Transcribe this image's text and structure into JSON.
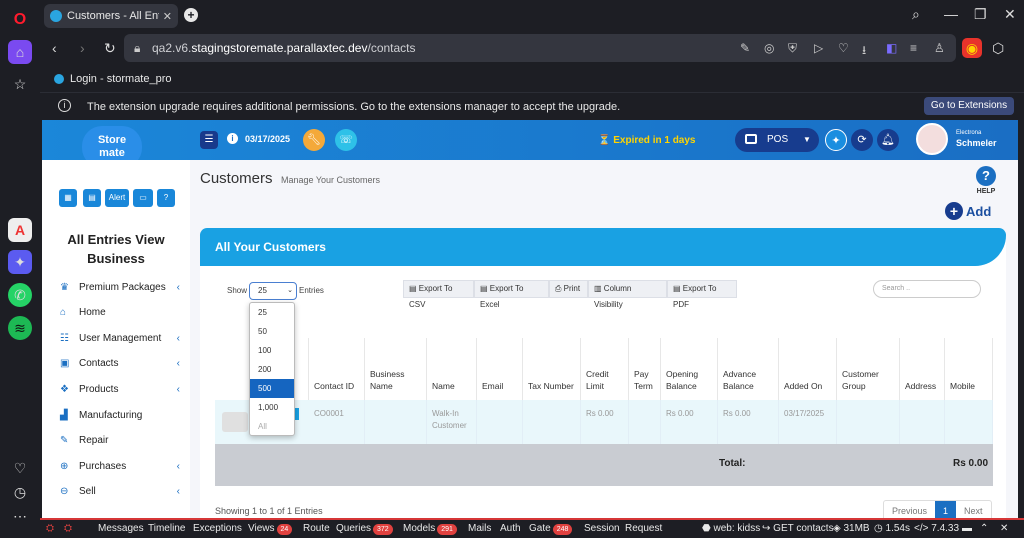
{
  "browser": {
    "tab_title": "Customers - All Entries Vi",
    "url_prefix": "qa2.v6.",
    "url_host": "stagingstoremate.parallaxtec.dev",
    "url_path": "/contacts",
    "bookmark": "Login - stormate_pro",
    "infobar_text": "The extension upgrade requires additional permissions. Go to the extensions manager to accept the upgrade.",
    "infobar_button": "Go to Extensions"
  },
  "topbar": {
    "date": "03/17/2025",
    "expired": "Expired in 1 days",
    "pos_label": "POS",
    "user_line1": "Electrona",
    "user_line2": "Schmeler"
  },
  "logo": {
    "line1": "Store",
    "line2": "mate"
  },
  "quick_buttons": {
    "alert": "Alert"
  },
  "business_name": "All Entries View Business",
  "nav": [
    {
      "label": "Premium Packages",
      "icon": "crown-icon",
      "chevron": true
    },
    {
      "label": "Home",
      "icon": "home-icon",
      "chevron": false
    },
    {
      "label": "User Management",
      "icon": "users-icon",
      "chevron": true
    },
    {
      "label": "Contacts",
      "icon": "contacts-icon",
      "chevron": true
    },
    {
      "label": "Products",
      "icon": "products-icon",
      "chevron": true
    },
    {
      "label": "Manufacturing",
      "icon": "factory-icon",
      "chevron": false
    },
    {
      "label": "Repair",
      "icon": "wrench-icon",
      "chevron": false
    },
    {
      "label": "Purchases",
      "icon": "download-circle-icon",
      "chevron": true
    },
    {
      "label": "Sell",
      "icon": "upload-circle-icon",
      "chevron": true
    }
  ],
  "page": {
    "title": "Customers",
    "subtitle": "Manage Your Customers",
    "help": "HELP",
    "add": "Add",
    "card_title": "All Your Customers",
    "show_label": "Show",
    "show_value": "25",
    "entries_label": "Entries",
    "search_placeholder": "Search ..",
    "showing_text": "Showing 1 to 1 of 1 Entries",
    "total_label": "Total:",
    "total_value": "Rs 0.00"
  },
  "export_buttons": [
    "Export To CSV",
    "Export To Excel",
    "Print",
    "Column Visibility",
    "Export To PDF"
  ],
  "columns": [
    "Contact ID",
    "Business Name",
    "Name",
    "Email",
    "Tax Number",
    "Credit Limit",
    "Pay Term",
    "Opening Balance",
    "Advance Balance",
    "Added On",
    "Customer Group",
    "Address",
    "Mobile"
  ],
  "rows": [
    {
      "contact_id": "CO0001",
      "business_name": "",
      "name": "Walk-In Customer",
      "email": "",
      "tax_number": "",
      "credit_limit": "Rs 0.00",
      "pay_term": "",
      "opening_balance": "Rs 0.00",
      "advance_balance": "Rs 0.00",
      "added_on": "03/17/2025",
      "customer_group": "",
      "address": "",
      "mobile": ""
    }
  ],
  "dropdown_options": [
    "25",
    "50",
    "100",
    "200",
    "500",
    "1,000",
    "All"
  ],
  "dropdown_highlighted": "500",
  "pagination": {
    "previous": "Previous",
    "current": "1",
    "next": "Next"
  },
  "debugbar": {
    "items": [
      "Messages",
      "Timeline",
      "Exceptions",
      "Views",
      "Route",
      "Queries",
      "Models",
      "Mails",
      "Auth",
      "Gate",
      "Session",
      "Request"
    ],
    "views_count": "24",
    "queries_count": "372",
    "models_count": "291",
    "gate_count": "248",
    "right": "web: kidss",
    "method": "GET contacts",
    "memory": "31MB",
    "time": "1.54s",
    "php": "7.4.33"
  }
}
